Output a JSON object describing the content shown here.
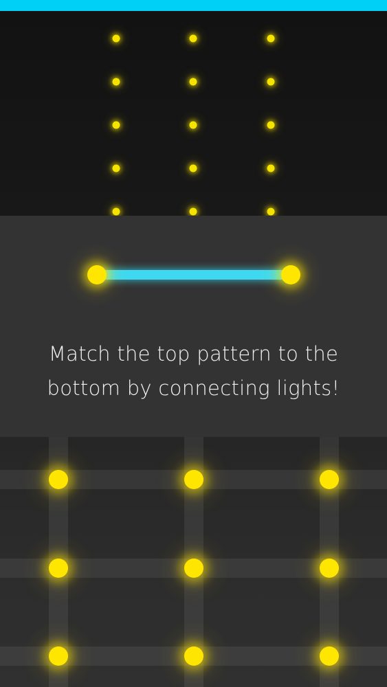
{
  "colors": {
    "accent_bar": "#00d0f6",
    "light": "#ffe600",
    "connection": "#3fd8f2",
    "panel": "#333334",
    "background": "#111111"
  },
  "tutorial": {
    "message": "Match the top pattern to the bottom by connecting lights!",
    "demo": {
      "connected_lights": 2,
      "connection_icon": "line-connector"
    }
  },
  "target_pattern": {
    "columns": 3,
    "visible_rows": 5,
    "icon": "light-dot"
  },
  "board": {
    "columns": 3,
    "rows": 3,
    "icon": "light-dot"
  }
}
